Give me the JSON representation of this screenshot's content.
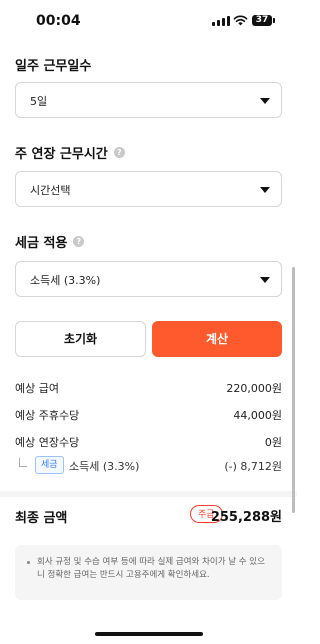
{
  "status_bar": {
    "time": "00:04",
    "battery": "37"
  },
  "weekly_workdays": {
    "title": "일주 근무일수",
    "value": "5일"
  },
  "extended_hours": {
    "title": "주 연장 근무시간",
    "value": "시간선택"
  },
  "tax": {
    "title": "세금 적용",
    "value": "소득세 (3.3%)"
  },
  "buttons": {
    "reset": "초기화",
    "calculate": "계산"
  },
  "results": [
    {
      "label": "예상 급여",
      "amount": "220,000원"
    },
    {
      "label": "예상 주휴수당",
      "amount": "44,000원"
    },
    {
      "label": "예상 연장수당",
      "amount": "0원"
    }
  ],
  "tax_line": {
    "badge": "세금",
    "label": "소득세 (3.3%)",
    "amount": "(-) 8,712원"
  },
  "total": {
    "label": "최종 금액",
    "badge": "주급",
    "amount": "255,288원"
  },
  "notice": "회사 규정 및 수습 여부 등에 따라 실제 급여와 차이가 날 수 있으니 정확한 급여는 반드시 고용주에게 확인하세요.",
  "colors": {
    "accent": "#ff5a2e",
    "badge_blue": "#3a82f7",
    "badge_red": "#ff3b30"
  }
}
